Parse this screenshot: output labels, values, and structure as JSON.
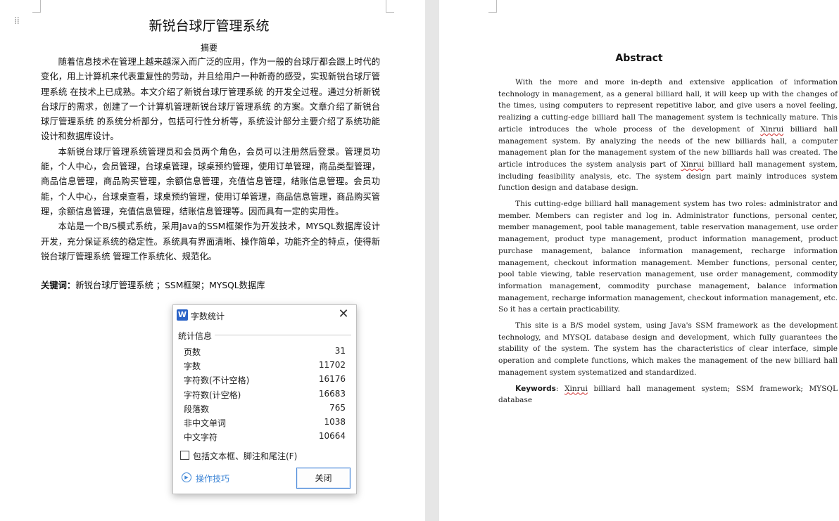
{
  "left_page": {
    "title": "新锐台球厅管理系统",
    "subtitle": "摘要",
    "paragraphs": [
      "随着信息技术在管理上越来越深入而广泛的应用，作为一般的台球厅都会跟上时代的变化，用上计算机来代表重复性的劳动，并且给用户一种新奇的感受，实现新锐台球厅管理系统 在技术上已成熟。本文介绍了新锐台球厅管理系统 的开发全过程。通过分析新锐台球厅的需求，创建了一个计算机管理新锐台球厅管理系统 的方案。文章介绍了新锐台球厅管理系统 的系统分析部分，包括可行性分析等，系统设计部分主要介绍了系统功能设计和数据库设计。",
      "本新锐台球厅管理系统管理员和会员两个角色，会员可以注册然后登录。管理员功能，个人中心，会员管理，台球桌管理，球桌预约管理，使用订单管理，商品类型管理，商品信息管理，商品购买管理，余额信息管理，充值信息管理，结账信息管理。会员功能，个人中心，台球桌查看，球桌预约管理，使用订单管理，商品信息管理，商品购买管理，余额信息管理，充值信息管理，结账信息管理等。因而具有一定的实用性。",
      "本站是一个B/S模式系统，采用Java的SSM框架作为开发技术，MYSQL数据库设计开发，充分保证系统的稳定性。系统具有界面清晰、操作简单，功能齐全的特点，使得新锐台球厅管理系统 管理工作系统化、规范化。"
    ],
    "keywords_label": "关键词：",
    "keywords_text": "新锐台球厅管理系统 ；SSM框架；MYSQL数据库"
  },
  "right_page": {
    "title": "Abstract",
    "para1_pre": "With the more and more in-depth and extensive application of information technology in management, as a general billiard hall, it will keep up with the changes of the times, using computers to represent repetitive labor, and give users a novel feeling, realizing a cutting-edge billiard hall The management system is technically mature. This article introduces the whole process of the development of ",
    "para1_word1": "Xinrui",
    "para1_mid": " billiard hall management system. By analyzing the needs of the new billiards hall, a computer management plan for the management system of the new billiards hall was created. The article introduces the system analysis part of ",
    "para1_word2": "Xinrui",
    "para1_post": " billiard hall management system, including feasibility analysis, etc. The system design part mainly introduces system function design and database design.",
    "para2": "This cutting-edge billiard hall management system has two roles: administrator and member. Members can register and log in. Administrator functions, personal center, member management, pool table management, table reservation management, use order management, product type management, product information management, product purchase management, balance information management, recharge information management, checkout information management. Member functions, personal center, pool table viewing, table reservation management, use order management, commodity information management, commodity purchase management, balance information management, recharge information management, checkout information management, etc. So it has a certain practicability.",
    "para3": "This site is a B/S model system, using Java's SSM framework as the development technology, and MYSQL database design and development, which fully guarantees the stability of the system. The system has the characteristics of clear interface, simple operation and complete functions, which makes the management of the new billiard hall management system systematized and standardized.",
    "keywords_label": "Keywords",
    "keywords_colon": ": ",
    "keywords_word": "Xinrui",
    "keywords_rest": " billiard hall management system; SSM framework; MYSQL database"
  },
  "dialog": {
    "logo": "W",
    "title": "字数统计",
    "close_glyph": "✕",
    "section_label": "统计信息",
    "stats": [
      {
        "label": "页数",
        "value": "31"
      },
      {
        "label": "字数",
        "value": "11702"
      },
      {
        "label": "字符数(不计空格)",
        "value": "16176"
      },
      {
        "label": "字符数(计空格)",
        "value": "16683"
      },
      {
        "label": "段落数",
        "value": "765"
      },
      {
        "label": "非中文单词",
        "value": "1038"
      },
      {
        "label": "中文字符",
        "value": "10664"
      }
    ],
    "checkbox_label": "包括文本框、脚注和尾注(F)",
    "checkbox_checked": false,
    "tips_label": "操作技巧",
    "close_button_label": "关闭"
  }
}
